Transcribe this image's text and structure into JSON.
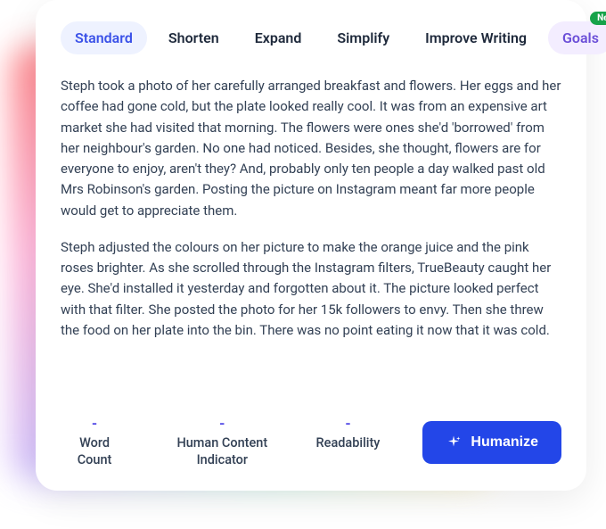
{
  "tabs": {
    "standard": "Standard",
    "shorten": "Shorten",
    "expand": "Expand",
    "simplify": "Simplify",
    "improve": "Improve Writing",
    "goals": "Goals",
    "newBadge": "New"
  },
  "content": {
    "p1": "Steph took a photo of her carefully arranged breakfast and flowers. Her eggs and her coffee had gone cold, but the plate looked really cool. It was from an expensive art market she had visited that morning. The flowers were ones she'd 'borrowed' from her neighbour's garden. No one had noticed. Besides, she thought, flowers are for everyone to enjoy, aren't they? And, probably only ten people a day walked past old Mrs Robinson's garden. Posting the picture on Instagram meant far more people would get to appreciate them.",
    "p2": "Steph adjusted the colours on her picture to make the orange juice and the pink roses brighter. As she scrolled through the Instagram filters, TrueBeauty caught her eye. She'd installed it yesterday and forgotten about it. The picture looked perfect with that filter. She posted the photo for her 15k followers to envy. Then she threw the food on her plate into the bin. There was no point eating it now that it was cold."
  },
  "metrics": {
    "wordCount": {
      "value": "-",
      "label": "Word Count"
    },
    "humanContent": {
      "value": "-",
      "label": "Human Content Indicator"
    },
    "readability": {
      "value": "-",
      "label": "Readability"
    }
  },
  "actions": {
    "humanize": "Humanize"
  }
}
